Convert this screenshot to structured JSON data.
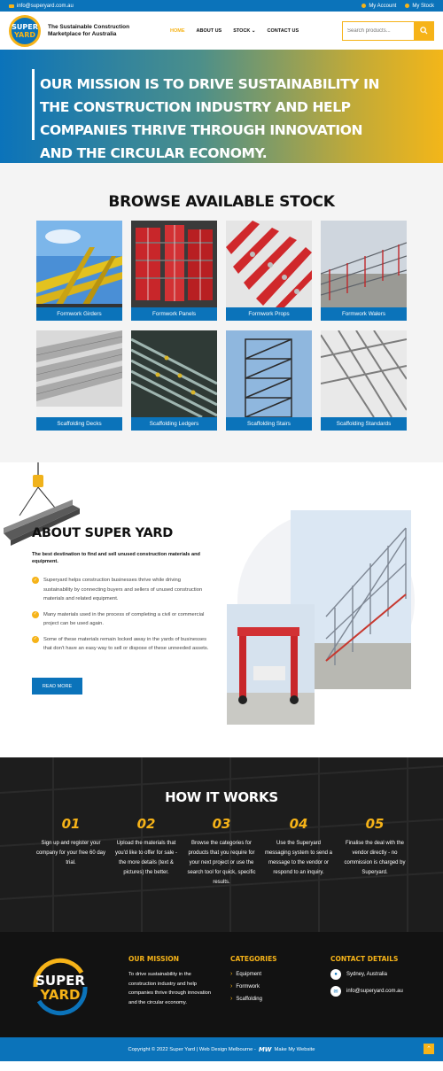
{
  "topbar": {
    "email": "info@superyard.com.au",
    "account": "My Account",
    "stock": "My Stock"
  },
  "header": {
    "logo_line1": "SUPER",
    "logo_line2": "YARD",
    "tagline": "The Sustainable Construction Marketplace for Australia",
    "nav": [
      {
        "label": "HOME",
        "active": true
      },
      {
        "label": "ABOUT US"
      },
      {
        "label": "STOCK"
      },
      {
        "label": "CONTACT US"
      }
    ],
    "search_placeholder": "Search products..."
  },
  "hero": {
    "mission": "OUR MISSION IS TO DRIVE SUSTAINABILITY IN THE CONSTRUCTION INDUSTRY AND HELP COMPANIES THRIVE THROUGH INNOVATION AND THE CIRCULAR ECONOMY."
  },
  "browse": {
    "title": "BROWSE AVAILABLE STOCK",
    "items": [
      {
        "label": "Formwork Girders"
      },
      {
        "label": "Formwork Panels"
      },
      {
        "label": "Formwork Props"
      },
      {
        "label": "Formwork Walers"
      },
      {
        "label": "Scaffolding Decks"
      },
      {
        "label": "Scaffolding Ledgers"
      },
      {
        "label": "Scaffolding Stairs"
      },
      {
        "label": "Scaffolding Standards"
      }
    ]
  },
  "about": {
    "title": "ABOUT SUPER YARD",
    "subtitle": "The best destination to find and sell unused construction materials and equipment.",
    "points": [
      "Superyard helps construction businesses thrive while driving sustainability by connecting buyers and sellers of unused construction materials and related equipment.",
      "Many materials used in the process of completing a civil or commercial project can be used again.",
      "Some of these materials remain locked away in the yards of businesses that don't have an easy way to sell or dispose of these unneeded assets."
    ],
    "button": "READ MORE"
  },
  "how": {
    "title": "HOW IT WORKS",
    "steps": [
      {
        "num": "01",
        "text": "Sign up and register your company for your free 60 day trial."
      },
      {
        "num": "02",
        "text": "Upload the materials that you'd like to offer for sale - the more details (text & pictures) the better."
      },
      {
        "num": "03",
        "text": "Browse the categories for products that you require for your next project or use the search tool for quick, specific results."
      },
      {
        "num": "04",
        "text": "Use the Superyard messaging system to send a message to the vendor or respond to an inquiry."
      },
      {
        "num": "05",
        "text": "Finalise the deal with the vendor directly - no commission is charged by Superyard."
      }
    ]
  },
  "footer": {
    "logo_line1": "SUPER",
    "logo_line2": "YARD",
    "mission_title": "OUR MISSION",
    "mission_text": "To drive sustainability in the construction industry and help companies thrive through innovation and the circular economy.",
    "categories_title": "CATEGORIES",
    "categories": [
      "Equipment",
      "Formwork",
      "Scaffolding"
    ],
    "contact_title": "CONTACT DETAILS",
    "location": "Sydney, Australia",
    "email": "info@superyard.com.au"
  },
  "copyright": {
    "text": "Copyright © 2022 Super Yard | Web Design Melbourne -",
    "brand_mark": "MW",
    "brand": "Make My Website"
  },
  "colors": {
    "brand_blue": "#0b73ba",
    "brand_yellow": "#f6b318",
    "dark": "#121212"
  }
}
